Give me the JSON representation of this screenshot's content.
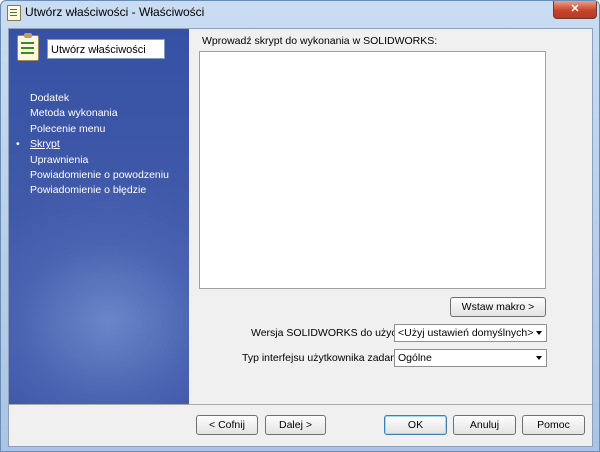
{
  "window": {
    "title": "Utwórz właściwości - Właściwości",
    "close_label": "✕"
  },
  "sidebar": {
    "name_value": "Utwórz właściwości",
    "items": [
      {
        "label": "Dodatek"
      },
      {
        "label": "Metoda wykonania"
      },
      {
        "label": "Polecenie menu"
      },
      {
        "label": "Skrypt",
        "active": true
      },
      {
        "label": "Uprawnienia"
      },
      {
        "label": "Powiadomienie o powodzeniu"
      },
      {
        "label": "Powiadomienie o błędzie"
      }
    ]
  },
  "main": {
    "prompt": "Wprowadź skrypt do wykonania w SOLIDWORKS:",
    "script_value": "",
    "insert_macro_label": "Wstaw makro >",
    "version_label": "Wersja SOLIDWORKS do użycia:",
    "version_value": "<Użyj ustawień domyślnych>",
    "ui_type_label": "Typ interfejsu użytkownika zadania:",
    "ui_type_value": "Ogólne"
  },
  "footer": {
    "back_label": "< Cofnij",
    "next_label": "Dalej >",
    "ok_label": "OK",
    "cancel_label": "Anuluj",
    "help_label": "Pomoc"
  },
  "icons": {
    "app": "clipboard-icon",
    "sidebar": "clipboard-checklist-icon",
    "dropdown": "chevron-down-icon"
  },
  "colors": {
    "sidebar_bg": "#3d56a6",
    "titlebar": "#b9d1ee",
    "close_button": "#c7452a"
  }
}
